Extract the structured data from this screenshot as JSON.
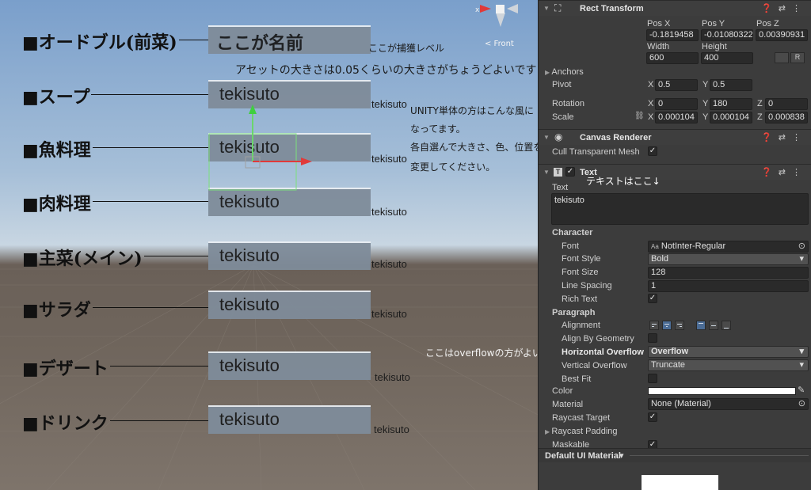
{
  "menu": [
    {
      "label": "■オードブル(前菜)",
      "panel": "ここが名前",
      "side": ""
    },
    {
      "label": "■スープ",
      "panel": "tekisuto",
      "side": "tekisuto"
    },
    {
      "label": "■魚料理",
      "panel": "tekisuto",
      "side": "tekisuto"
    },
    {
      "label": "■肉料理",
      "panel": "tekisuto",
      "side": "tekisuto"
    },
    {
      "label": "■主菜(メイン)",
      "panel": "tekisuto",
      "side": "tekisuto"
    },
    {
      "label": "■サラダ",
      "panel": "tekisuto",
      "side": "tekisuto"
    },
    {
      "label": "■デザート",
      "panel": "tekisuto",
      "side": "tekisuto"
    },
    {
      "label": "■ドリンク",
      "panel": "tekisuto",
      "side": "tekisuto"
    }
  ],
  "notes": {
    "capture_level": "ここが捕獲レベル",
    "asset_size": "アセットの大きさは0.05くらいの大きさがちょうどよいです",
    "unity_line1": "UNITY単体の方はこんな風に",
    "unity_line2": "なってます。",
    "unity_line3": "各自選んで大きさ、色、位置を",
    "unity_line4": "変更してください。",
    "text_here": "テキストはここ↓",
    "overflow_hint": "ここはoverflowの方がよいかも→"
  },
  "gizmo": {
    "front_label": "< Front",
    "x_label": "x"
  },
  "inspector": {
    "rect_transform": {
      "title": "Rect Transform",
      "pos_x_label": "Pos X",
      "pos_y_label": "Pos Y",
      "pos_z_label": "Pos Z",
      "pos_x": "-0.1819458",
      "pos_y": "-0.01080322",
      "pos_z": "0.00390931",
      "width_label": "Width",
      "height_label": "Height",
      "width": "600",
      "height": "400",
      "r_label": "R",
      "anchors": "Anchors",
      "pivot": "Pivot",
      "pivot_x": "0.5",
      "pivot_y": "0.5",
      "rotation": "Rotation",
      "rot_x": "0",
      "rot_y": "180",
      "rot_z": "0",
      "scale": "Scale",
      "scale_x": "0.000104",
      "scale_y": "0.000104",
      "scale_z": "0.000838",
      "axis_x": "X",
      "axis_y": "Y",
      "axis_z": "Z"
    },
    "canvas_renderer": {
      "title": "Canvas Renderer",
      "cull": "Cull Transparent Mesh"
    },
    "text_component": {
      "title": "Text",
      "text_label": "Text",
      "text_value": "tekisuto",
      "character": "Character",
      "font_label": "Font",
      "font_value": "NotInter-Regular",
      "font_prefix": "Aa",
      "font_style_label": "Font Style",
      "font_style_value": "Bold",
      "font_size_label": "Font Size",
      "font_size_value": "128",
      "line_spacing_label": "Line Spacing",
      "line_spacing_value": "1",
      "rich_text_label": "Rich Text",
      "paragraph": "Paragraph",
      "alignment_label": "Alignment",
      "align_geometry_label": "Align By Geometry",
      "h_overflow_label": "Horizontal Overflow",
      "h_overflow_value": "Overflow",
      "v_overflow_label": "Vertical Overflow",
      "v_overflow_value": "Truncate",
      "best_fit_label": "Best Fit",
      "color_label": "Color",
      "material_label": "Material",
      "material_value": "None (Material)",
      "raycast_target_label": "Raycast Target",
      "raycast_padding_label": "Raycast Padding",
      "maskable_label": "Maskable"
    },
    "material_footer": "Default UI Material",
    "checkmark": "✓"
  }
}
